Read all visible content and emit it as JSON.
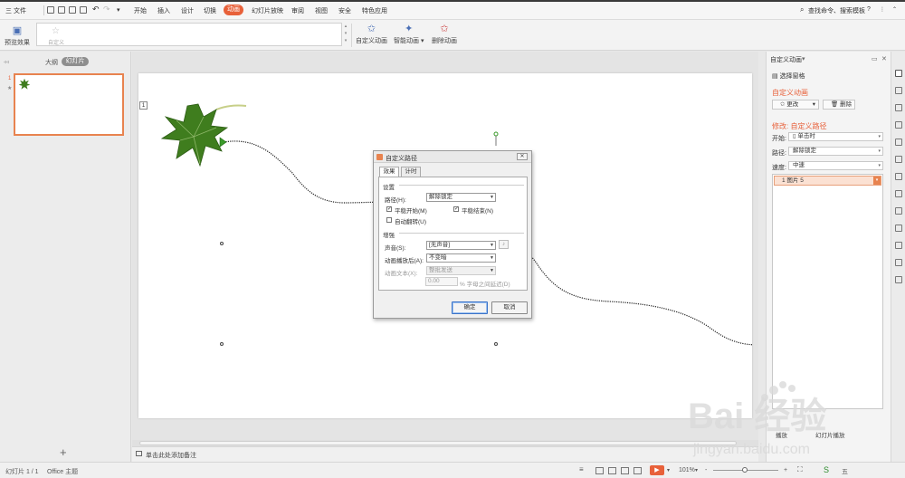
{
  "menubar": {
    "file_label": "三 文件",
    "tabs": [
      "开始",
      "插入",
      "设计",
      "切换",
      "动画",
      "幻灯片放映",
      "审阅",
      "视图",
      "安全",
      "特色应用"
    ],
    "active_tab": "动画",
    "search_label": "查找命令、搜索模板",
    "help_label": "?"
  },
  "ribbon": {
    "preview_label": "预览效果",
    "gallery_item": "自定义",
    "custom_anim_label": "自定义动画",
    "smart_anim_label": "智能动画",
    "delete_anim_label": "删除动画"
  },
  "leftpanel": {
    "tab_outline": "大纲",
    "tab_slides": "幻灯片",
    "slide_number": "1"
  },
  "slide": {
    "anim_tag": "1"
  },
  "notes": {
    "placeholder": "单击此处添加备注"
  },
  "pane": {
    "title": "自定义动画",
    "select_pane_label": "选择窗格",
    "heading_custom": "自定义动画",
    "change_button": "更改",
    "delete_button": "删除",
    "heading_modify": "修改: 自定义路径",
    "start_label": "开始:",
    "start_value": "单击时",
    "path_label": "路径:",
    "path_value": "解除锁定",
    "speed_label": "速度:",
    "speed_value": "中速",
    "list_item": "1  图片 5",
    "play_button": "播放",
    "slideshow_button": "幻灯片播放"
  },
  "dialog": {
    "title": "自定义路径",
    "tab_effect": "效果",
    "tab_timing": "计时",
    "group_settings": "设置",
    "path_label": "路径(H):",
    "path_value": "解除锁定",
    "smooth_start": "平稳开始(M)",
    "smooth_end": "平稳结束(N)",
    "auto_reverse": "自动翻转(U)",
    "group_enhance": "增强",
    "sound_label": "声音(S):",
    "sound_value": "[无声音]",
    "after_anim_label": "动画播放后(A):",
    "after_anim_value": "不变暗",
    "anim_text_label": "动画文本(X):",
    "anim_text_value": "整批发送",
    "delay_value": "0.00",
    "delay_hint": "% 字母之间延迟(D)",
    "ok_button": "确定",
    "cancel_button": "取消"
  },
  "statusbar": {
    "slide_info": "幻灯片 1 / 1",
    "theme": "Office 主题",
    "zoom": "101%",
    "zoom_minus": "-",
    "zoom_plus": "+"
  },
  "watermark": {
    "brand": "Bai 经验",
    "url": "jingyan.baidu.com"
  },
  "colors": {
    "accent": "#e8613a",
    "leaf": "#3f7d1e"
  }
}
